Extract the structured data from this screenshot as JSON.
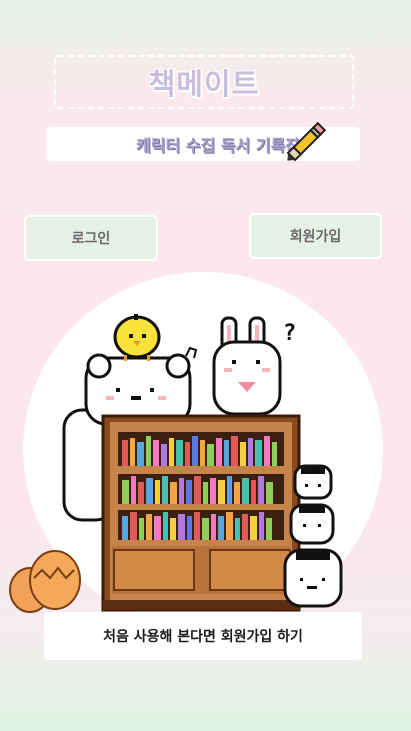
{
  "header": {
    "app_title": "책메이트",
    "subtitle": "캐릭터 수집 독서 기록장"
  },
  "auth": {
    "login_label": "로그인",
    "signup_label": "회원가입"
  },
  "footer": {
    "hint_label": "처음 사용해 본다면 회원가입 하기"
  },
  "icons": {
    "pencil": "pencil-icon",
    "chick": "chick-character",
    "bunny": "bunny-character",
    "bear": "polar-bear-character",
    "bookshelf": "bookshelf-illustration",
    "eggs": "egg-pair-illustration",
    "rice_balls": "rice-ball-stack-characters"
  },
  "colors": {
    "title_text": "#c7bedf",
    "button_bg": "#e5f0e6",
    "shelf_wood": "#b8743a"
  }
}
